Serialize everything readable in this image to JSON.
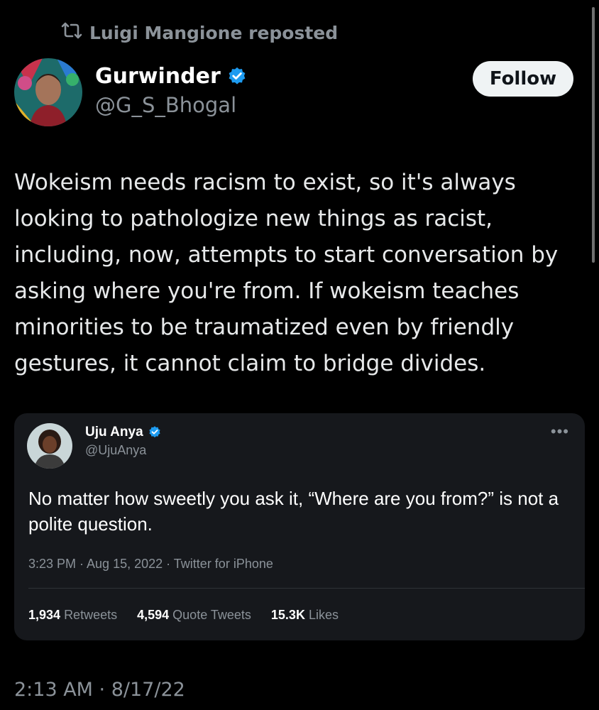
{
  "repost": {
    "text": "Luigi Mangione reposted",
    "icon": "repost-icon"
  },
  "author": {
    "name": "Gurwinder",
    "handle": "@G_S_Bhogal",
    "verified": true,
    "badge_color": "#1d9bf0"
  },
  "follow_label": "Follow",
  "tweet_text": "Wokeism needs racism to exist, so it's always\nlooking to pathologize new things as racist,\nincluding, now, attempts to start conversation by\nasking where you're from. If wokeism teaches\nminorities to be traumatized even by friendly\ngestures, it cannot claim to bridge divides.",
  "quote": {
    "name": "Uju Anya",
    "handle": "@UjuAnya",
    "verified": true,
    "more": "•••",
    "text": "No matter how sweetly you ask it, “Where are you from?” is not a polite question.",
    "meta": "3:23 PM · Aug 15, 2022 · Twitter for iPhone",
    "stats": {
      "retweets_num": "1,934",
      "retweets_label": "Retweets",
      "quotes_num": "4,594",
      "quotes_label": "Quote Tweets",
      "likes_num": "15.3K",
      "likes_label": "Likes"
    }
  },
  "timestamp": "2:13 AM · 8/17/22",
  "colors": {
    "background": "#000000",
    "text": "#e7e9ea",
    "muted": "#8b9299",
    "card": "#16181c"
  }
}
